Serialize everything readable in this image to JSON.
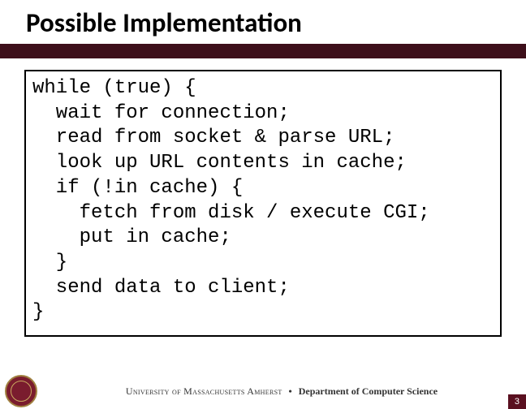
{
  "slide": {
    "title": "Possible Implementation"
  },
  "code": {
    "lines": [
      "while (true) {",
      "  wait for connection;",
      "  read from socket & parse URL;",
      "  look up URL contents in cache;",
      "  if (!in cache) {",
      "    fetch from disk / execute CGI;",
      "    put in cache;",
      "  }",
      "  send data to client;",
      "}"
    ]
  },
  "footer": {
    "university": "University of Massachusetts Amherst",
    "separator": "•",
    "department": "Department of Computer Science",
    "page": "3"
  }
}
